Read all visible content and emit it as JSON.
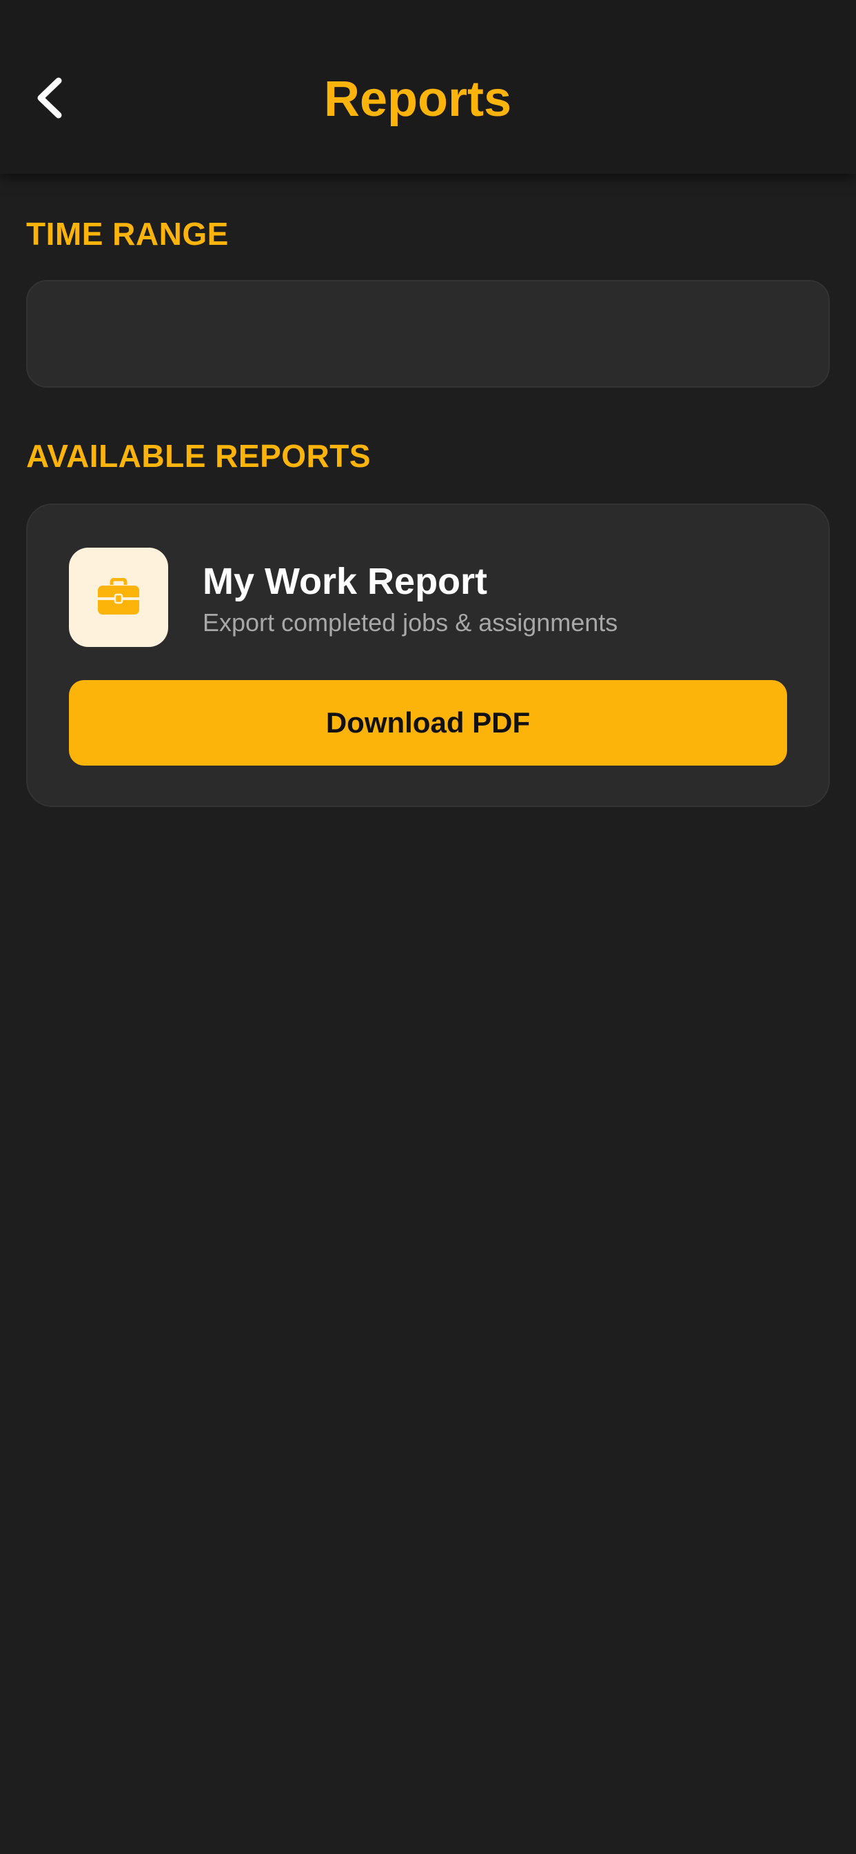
{
  "header": {
    "title": "Reports",
    "back_icon": "chevron-left-icon"
  },
  "time_range": {
    "label": "TIME RANGE"
  },
  "available_reports": {
    "label": "AVAILABLE REPORTS",
    "items": [
      {
        "icon": "briefcase-icon",
        "title": "My Work Report",
        "subtitle": "Export completed jobs & assignments",
        "button_label": "Download PDF"
      }
    ]
  },
  "colors": {
    "accent": "#fcb40a",
    "background": "#1e1e1e",
    "card": "#2b2b2b",
    "icon_tile": "#fff2dc"
  }
}
